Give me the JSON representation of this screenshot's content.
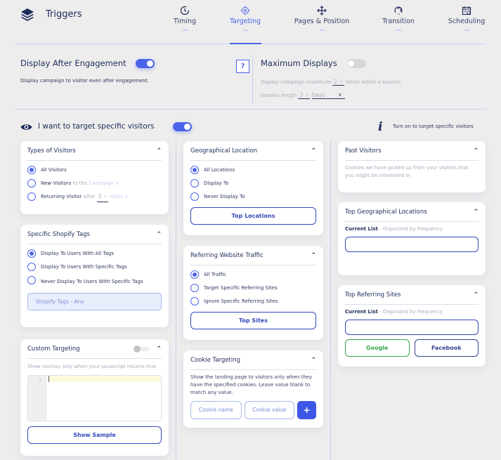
{
  "header": {
    "title": "Triggers",
    "logo_icon": "layers-icon",
    "tabs": [
      {
        "label": "Timing",
        "icon": "clock-icon",
        "active": false
      },
      {
        "label": "Targeting",
        "icon": "crosshair-icon",
        "active": true
      },
      {
        "label": "Pages & Position",
        "icon": "move-arrows-icon",
        "active": false
      },
      {
        "label": "Transition",
        "icon": "transition-icon",
        "active": false
      },
      {
        "label": "Scheduling",
        "icon": "calendar-icon",
        "active": false
      }
    ]
  },
  "engagement": {
    "title": "Display After Engagement",
    "enabled": true,
    "description": "Display campaign to visitor even after engagement.",
    "help_label": "?"
  },
  "max_displays": {
    "title": "Maximum Displays",
    "enabled": false,
    "line1_prefix": "Display campaign maximum",
    "max_value": "2",
    "line1_suffix": "times within a session.",
    "line2_prefix": "Session length",
    "session_length": "3",
    "session_unit": "Days",
    "spinner_glyph": "÷",
    "chevron_glyph": "⌄"
  },
  "targeting": {
    "label": "I want to target specific visitors",
    "enabled": true,
    "info_text": "Turn on to target specific visitors"
  },
  "cards": {
    "types_of_visitors": {
      "title": "Types of Visitors",
      "options": [
        "All Visitors",
        "New Visitors",
        "Returning Visitor"
      ],
      "selected": 0,
      "new_suffix": "to the",
      "new_select": "Campaign",
      "returning_after": "After",
      "returning_value": "3",
      "returning_unit": "Visits"
    },
    "shopify_tags": {
      "title": "Specific Shopify Tags",
      "options": [
        "Display To Users With All Tags",
        "Display To Users With Specific Tags",
        "Never Display To Users With Specific Tags"
      ],
      "selected": 0,
      "tags_field": "Shopify Tags - Any"
    },
    "custom_targeting": {
      "title": "Custom Targeting",
      "enabled": false,
      "description": "Show overlay only when your javascript returns true",
      "line_number": "1",
      "button": "Show Sample"
    },
    "geo_location": {
      "title": "Geographical Location",
      "options": [
        "All Locations",
        "Display To",
        "Never Display To"
      ],
      "selected": 0,
      "button": "Top Locations"
    },
    "referring_traffic": {
      "title": "Referring Website Traffic",
      "options": [
        "All Traffic",
        "Target Specific Referring Sites",
        "Ignore Specific Referring Sites"
      ],
      "selected": 0,
      "button": "Top Sites"
    },
    "cookie_targeting": {
      "title": "Cookie Targeting",
      "description": "Show the landing page to visitors only when they have the specified cookies. Leave value blank to match any value.",
      "name_placeholder": "Cookie name",
      "value_placeholder": "Cookie value",
      "add_label": "+"
    },
    "past_visitors": {
      "title": "Past Visitors",
      "description": "Cookies we have picked up from your visitors that you might be interested in"
    },
    "top_geo": {
      "title": "Top Geographical Locations",
      "list_label": "Current List",
      "list_sub": "- Organized by Frequency",
      "value": ""
    },
    "top_referring": {
      "title": "Top Referring Sites",
      "list_label": "Current List",
      "list_sub": "- Organized by Frequency",
      "value": "",
      "buttons": [
        "Google",
        "Facebook"
      ]
    }
  },
  "colors": {
    "accent": "#4b63e8",
    "navy": "#1e2a5a",
    "google_green": "#3aa64a",
    "background": "#ededed"
  }
}
